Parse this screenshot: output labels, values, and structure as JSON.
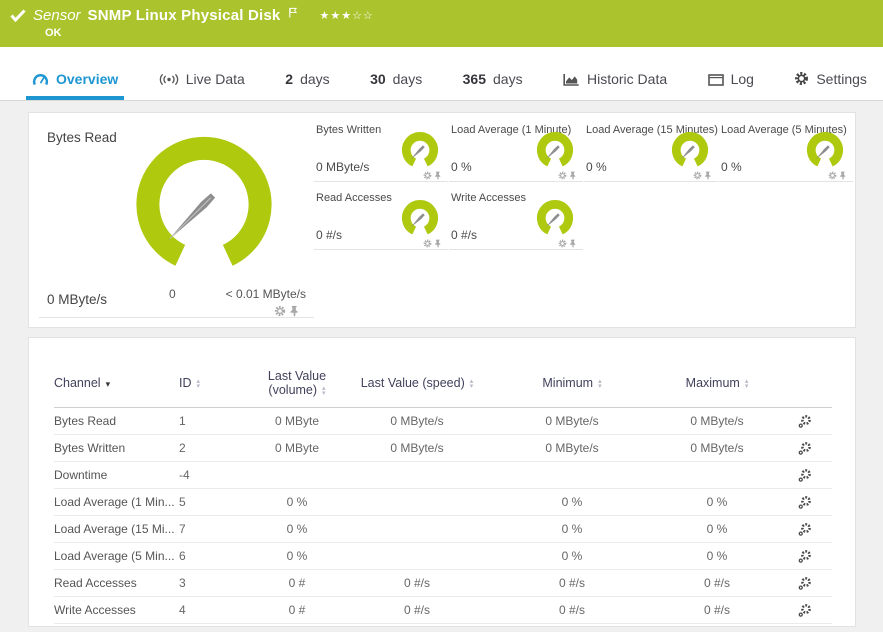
{
  "header": {
    "type_label": "Sensor",
    "sensor_name": "SNMP Linux Physical Disk",
    "status": "OK",
    "rating_filled": "★★★",
    "rating_empty": "☆☆"
  },
  "tabs": [
    {
      "icon": "gauge-icon",
      "label": "Overview",
      "active": true
    },
    {
      "icon": "live-icon",
      "label": "Live Data"
    },
    {
      "num": "2",
      "label": "days"
    },
    {
      "num": "30",
      "label": "days"
    },
    {
      "num": "365",
      "label": "days"
    },
    {
      "icon": "chart-icon",
      "label": "Historic Data"
    },
    {
      "icon": "window-icon",
      "label": "Log"
    },
    {
      "icon": "gear-icon",
      "label": "Settings"
    }
  ],
  "gauges": {
    "big": {
      "label": "Bytes Read",
      "value": "0 MByte/s",
      "min_label": "0",
      "max_label": "< 0.01 MByte/s"
    },
    "small": [
      {
        "label": "Bytes Written",
        "value": "0 MByte/s"
      },
      {
        "label": "Load Average (1 Minute)",
        "value": "0 %"
      },
      {
        "label": "Load Average (15 Minutes)",
        "value": "0 %"
      },
      {
        "label": "Load Average (5 Minutes)",
        "value": "0 %"
      },
      {
        "label": "Read Accesses",
        "value": "0 #/s"
      },
      {
        "label": "Write Accesses",
        "value": "0 #/s"
      }
    ]
  },
  "channel_table": {
    "headers": {
      "channel": "Channel",
      "id": "ID",
      "volume_line1": "Last Value",
      "volume_line2": "(volume)",
      "speed": "Last Value (speed)",
      "min": "Minimum",
      "max": "Maximum"
    },
    "rows": [
      {
        "channel": "Bytes Read",
        "id": "1",
        "volume": "0 MByte",
        "speed": "0 MByte/s",
        "min": "0 MByte/s",
        "max": "0 MByte/s"
      },
      {
        "channel": "Bytes Written",
        "id": "2",
        "volume": "0 MByte",
        "speed": "0 MByte/s",
        "min": "0 MByte/s",
        "max": "0 MByte/s"
      },
      {
        "channel": "Downtime",
        "id": "-4",
        "volume": "",
        "speed": "",
        "min": "",
        "max": ""
      },
      {
        "channel": "Load Average (1 Min...",
        "id": "5",
        "volume": "0 %",
        "speed": "",
        "min": "0 %",
        "max": "0 %"
      },
      {
        "channel": "Load Average (15 Mi...",
        "id": "7",
        "volume": "0 %",
        "speed": "",
        "min": "0 %",
        "max": "0 %"
      },
      {
        "channel": "Load Average (5 Min...",
        "id": "6",
        "volume": "0 %",
        "speed": "",
        "min": "0 %",
        "max": "0 %"
      },
      {
        "channel": "Read Accesses",
        "id": "3",
        "volume": "0 #",
        "speed": "0 #/s",
        "min": "0 #/s",
        "max": "0 #/s"
      },
      {
        "channel": "Write Accesses",
        "id": "4",
        "volume": "0 #",
        "speed": "0 #/s",
        "min": "0 #/s",
        "max": "0 #/s"
      }
    ]
  },
  "colors": {
    "header_green": "#abc32d",
    "gauge_green": "#aec90e",
    "tab_blue": "#1d96d2"
  }
}
